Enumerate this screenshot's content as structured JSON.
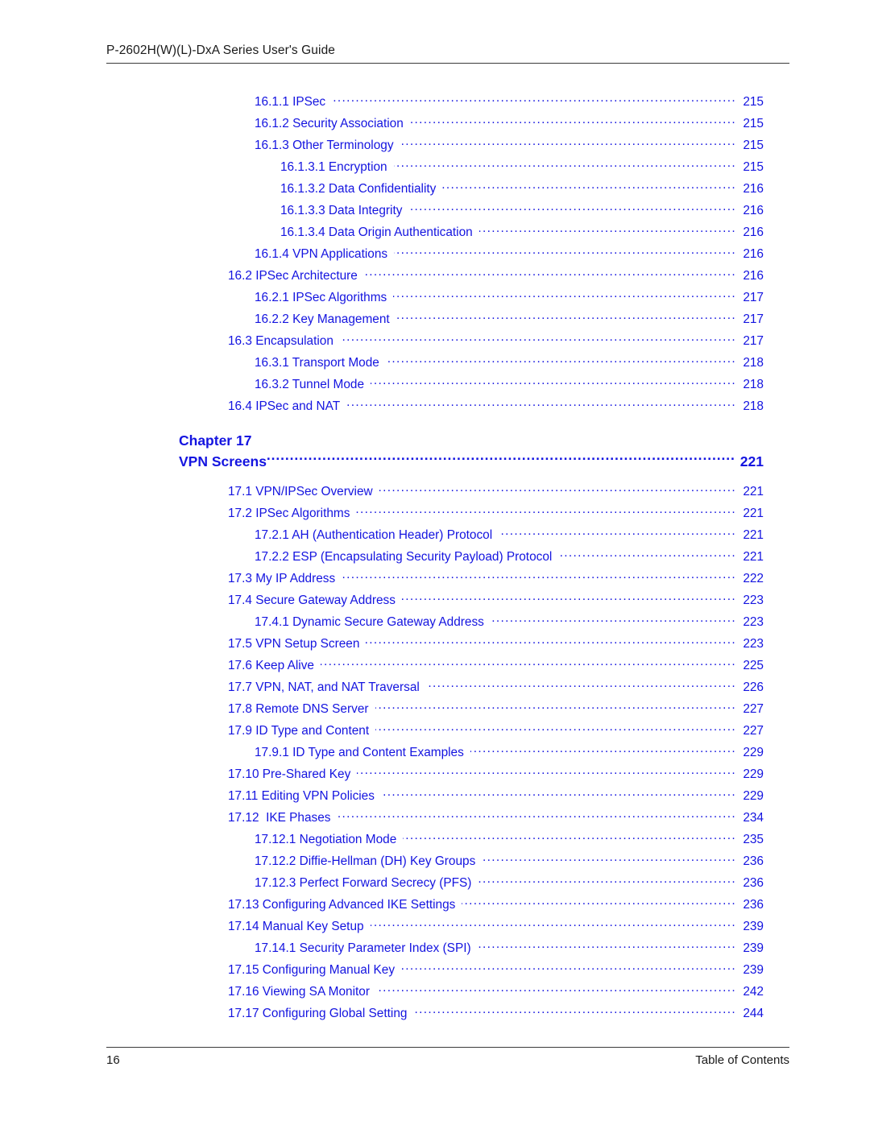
{
  "header": {
    "title": "P-2602H(W)(L)-DxA Series User's Guide"
  },
  "colors": {
    "toc_blue": "#1414e0",
    "body_black": "#1a1a1a",
    "rule": "#3a3a3a"
  },
  "toc": {
    "entries_before_chapter": [
      {
        "label": "16.1.1 IPSec",
        "page": "215",
        "level": 2
      },
      {
        "label": "16.1.2 Security Association",
        "page": "215",
        "level": 2
      },
      {
        "label": "16.1.3 Other Terminology",
        "page": "215",
        "level": 2
      },
      {
        "label": "16.1.3.1 Encryption",
        "page": "215",
        "level": 3
      },
      {
        "label": "16.1.3.2 Data Confidentiality",
        "page": "216",
        "level": 3
      },
      {
        "label": "16.1.3.3 Data Integrity",
        "page": "216",
        "level": 3
      },
      {
        "label": "16.1.3.4 Data Origin Authentication",
        "page": "216",
        "level": 3
      },
      {
        "label": "16.1.4 VPN Applications",
        "page": "216",
        "level": 2
      },
      {
        "label": "16.2 IPSec Architecture",
        "page": "216",
        "level": 1
      },
      {
        "label": "16.2.1 IPSec Algorithms",
        "page": "217",
        "level": 2
      },
      {
        "label": "16.2.2 Key Management",
        "page": "217",
        "level": 2
      },
      {
        "label": "16.3 Encapsulation",
        "page": "217",
        "level": 1
      },
      {
        "label": "16.3.1 Transport Mode",
        "page": "218",
        "level": 2
      },
      {
        "label": "16.3.2 Tunnel Mode",
        "page": "218",
        "level": 2
      },
      {
        "label": "16.4 IPSec and NAT",
        "page": "218",
        "level": 1
      }
    ],
    "chapter": {
      "number_label": "Chapter 17",
      "title": "VPN Screens",
      "page": "221"
    },
    "entries_after_chapter": [
      {
        "label": "17.1 VPN/IPSec Overview",
        "page": "221",
        "level": 1
      },
      {
        "label": "17.2 IPSec Algorithms",
        "page": "221",
        "level": 1
      },
      {
        "label": "17.2.1 AH (Authentication Header) Protocol",
        "page": "221",
        "level": 2
      },
      {
        "label": "17.2.2 ESP (Encapsulating Security Payload) Protocol",
        "page": "221",
        "level": 2
      },
      {
        "label": "17.3 My IP Address",
        "page": "222",
        "level": 1
      },
      {
        "label": "17.4 Secure Gateway Address",
        "page": "223",
        "level": 1
      },
      {
        "label": "17.4.1 Dynamic Secure Gateway Address",
        "page": "223",
        "level": 2
      },
      {
        "label": "17.5 VPN Setup Screen",
        "page": "223",
        "level": 1
      },
      {
        "label": "17.6 Keep Alive",
        "page": "225",
        "level": 1
      },
      {
        "label": "17.7 VPN, NAT, and NAT Traversal",
        "page": "226",
        "level": 1
      },
      {
        "label": "17.8 Remote DNS Server",
        "page": "227",
        "level": 1
      },
      {
        "label": "17.9 ID Type and Content",
        "page": "227",
        "level": 1
      },
      {
        "label": "17.9.1 ID Type and Content Examples",
        "page": "229",
        "level": 2
      },
      {
        "label": "17.10 Pre-Shared Key",
        "page": "229",
        "level": 1
      },
      {
        "label": "17.11 Editing VPN Policies",
        "page": "229",
        "level": 1
      },
      {
        "label": "17.12  IKE Phases",
        "page": "234",
        "level": 1
      },
      {
        "label": "17.12.1 Negotiation Mode",
        "page": "235",
        "level": 2
      },
      {
        "label": "17.12.2 Diffie-Hellman (DH) Key Groups",
        "page": "236",
        "level": 2
      },
      {
        "label": "17.12.3 Perfect Forward Secrecy (PFS)",
        "page": "236",
        "level": 2
      },
      {
        "label": "17.13 Configuring Advanced IKE Settings",
        "page": "236",
        "level": 1
      },
      {
        "label": "17.14 Manual Key Setup",
        "page": "239",
        "level": 1
      },
      {
        "label": "17.14.1 Security Parameter Index (SPI)",
        "page": "239",
        "level": 2
      },
      {
        "label": "17.15 Configuring Manual Key",
        "page": "239",
        "level": 1
      },
      {
        "label": "17.16 Viewing SA Monitor",
        "page": "242",
        "level": 1
      },
      {
        "label": "17.17 Configuring Global Setting",
        "page": "244",
        "level": 1
      }
    ]
  },
  "footer": {
    "page_number": "16",
    "section_name": "Table of Contents"
  }
}
